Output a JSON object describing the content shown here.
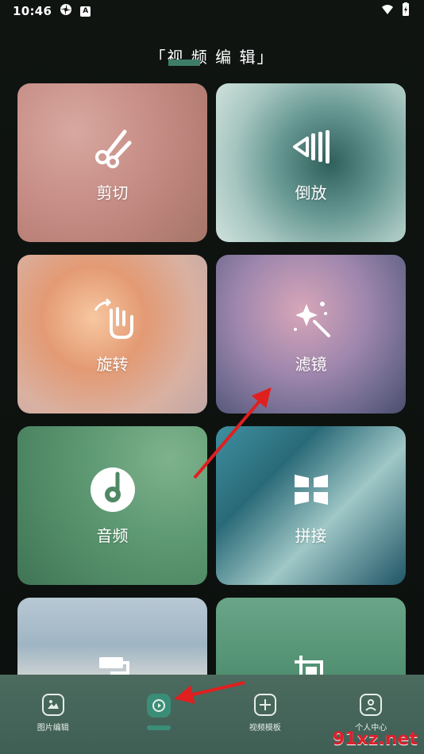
{
  "status_bar": {
    "time": "10:46",
    "badge_letter": "A"
  },
  "page": {
    "title": "「视 频 编 辑」"
  },
  "cards": [
    {
      "label": "剪切",
      "icon": "scissors-icon"
    },
    {
      "label": "倒放",
      "icon": "reverse-play-icon"
    },
    {
      "label": "旋转",
      "icon": "rotate-hand-icon"
    },
    {
      "label": "滤镜",
      "icon": "magic-wand-icon"
    },
    {
      "label": "音频",
      "icon": "music-disc-icon"
    },
    {
      "label": "拼接",
      "icon": "grid-splice-icon"
    },
    {
      "label": "",
      "icon": "paint-roller-icon"
    },
    {
      "label": "",
      "icon": "crop-icon"
    }
  ],
  "bottom_nav": {
    "items": [
      {
        "label": "图片编辑",
        "icon": "image-edit-icon"
      },
      {
        "label": "",
        "icon": "video-edit-icon",
        "active": true
      },
      {
        "label": "视频模板",
        "icon": "template-icon"
      },
      {
        "label": "个人中心",
        "icon": "profile-icon"
      }
    ]
  },
  "watermark": {
    "text": "91xz.net"
  },
  "colors": {
    "accent": "#3a8e77",
    "arrow": "#e01f1f"
  }
}
